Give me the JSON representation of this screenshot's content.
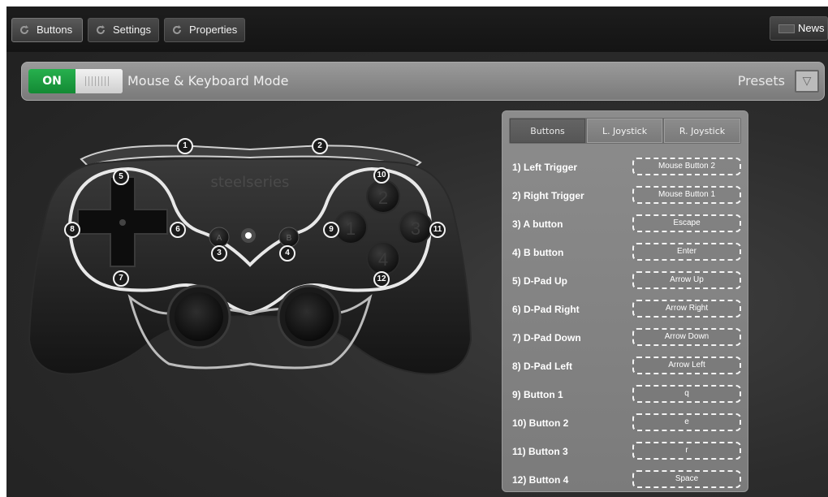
{
  "top_tabs": [
    {
      "label": "Buttons",
      "active": true,
      "icon": "refresh-icon"
    },
    {
      "label": "Settings",
      "active": false,
      "icon": "refresh-icon"
    },
    {
      "label": "Properties",
      "active": false,
      "icon": "refresh-icon"
    }
  ],
  "news": {
    "label": "News",
    "icon": "news-icon"
  },
  "mode_bar": {
    "toggle_label": "ON",
    "toggle_state": true,
    "mode_label": "Mouse & Keyboard Mode",
    "presets_label": "Presets",
    "presets_icon": "triangle-down-icon"
  },
  "controller": {
    "brand_text": "steelseries",
    "face_labels": {
      "a": "A",
      "b": "B",
      "btn1": "1",
      "btn2": "2",
      "btn3": "3",
      "btn4": "4"
    },
    "markers": [
      "1",
      "2",
      "3",
      "4",
      "5",
      "6",
      "7",
      "8",
      "9",
      "10",
      "11",
      "12"
    ]
  },
  "panel": {
    "tabs": [
      {
        "label": "Buttons",
        "active": true
      },
      {
        "label": "L. Joystick",
        "active": false
      },
      {
        "label": "R. Joystick",
        "active": false
      }
    ],
    "mappings": [
      {
        "label": "1) Left Trigger",
        "value": "Mouse Button 2"
      },
      {
        "label": "2) Right Trigger",
        "value": "Mouse Button 1"
      },
      {
        "label": "3) A button",
        "value": "Escape"
      },
      {
        "label": "4) B button",
        "value": "Enter"
      },
      {
        "label": "5) D-Pad Up",
        "value": "Arrow Up"
      },
      {
        "label": "6) D-Pad Right",
        "value": "Arrow Right"
      },
      {
        "label": "7) D-Pad Down",
        "value": "Arrow Down"
      },
      {
        "label": "8) D-Pad Left",
        "value": "Arrow Left"
      },
      {
        "label": "9) Button 1",
        "value": "q"
      },
      {
        "label": "10) Button 2",
        "value": "e"
      },
      {
        "label": "11) Button 3",
        "value": "r"
      },
      {
        "label": "12) Button 4",
        "value": "Space"
      }
    ]
  },
  "colors": {
    "toggle_on": "#1f9e42",
    "background": "#2a2a2a",
    "panel": "#858585"
  }
}
